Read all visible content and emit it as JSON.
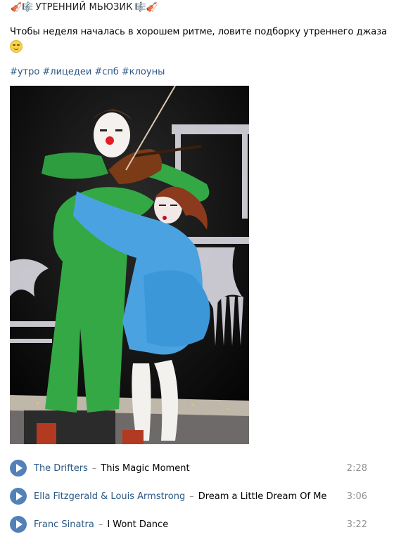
{
  "post": {
    "title_emoji_left": "🎻🎼",
    "title": "УТРЕННИЙ МЬЮЗИК",
    "title_emoji_right": "🎼🎻",
    "body": "Чтобы неделя началась в хорошем ритме, ловите подборку утреннего джаза",
    "tags": [
      "#утро",
      "#лицедеи",
      "#спб",
      "#клоуны"
    ]
  },
  "photo": {
    "subject": "clown-violinist-and-woman-in-blue-on-stage"
  },
  "tracks": [
    {
      "artist": "The Drifters",
      "separator": "–",
      "title": "This Magic Moment",
      "duration": "2:28"
    },
    {
      "artist": "Ella Fitzgerald & Louis Armstrong",
      "separator": "–",
      "title": "Dream a Little Dream Of Me",
      "duration": "3:06"
    },
    {
      "artist": "Franc Sinatra",
      "separator": "–",
      "title": "I Wont Dance",
      "duration": "3:22"
    }
  ],
  "colors": {
    "link": "#2a5885",
    "play_button": "#5181b8",
    "muted": "#939393"
  }
}
